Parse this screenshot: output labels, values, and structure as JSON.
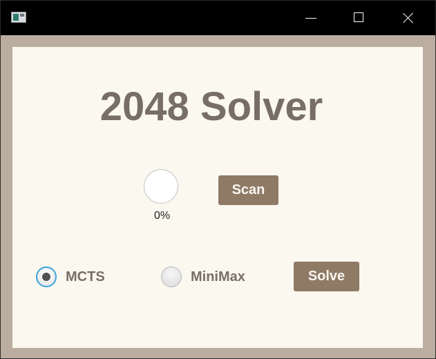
{
  "window": {
    "title": "",
    "minimize_icon": "minimize-icon",
    "maximize_icon": "maximize-icon",
    "close_icon": "close-icon"
  },
  "main": {
    "title": "2048 Solver",
    "progress": {
      "value_percent": 0,
      "label": "0%"
    },
    "scan_label": "Scan",
    "solve_label": "Solve",
    "algorithms": [
      {
        "label": "MCTS",
        "selected": true
      },
      {
        "label": "MiniMax",
        "selected": false
      }
    ]
  },
  "colors": {
    "frame": "#bbada0",
    "background": "#faf8ef",
    "text": "#776e65",
    "button": "#8f7a66",
    "button_text": "#f9f6f2",
    "radio_focus": "#3ba3dc"
  }
}
